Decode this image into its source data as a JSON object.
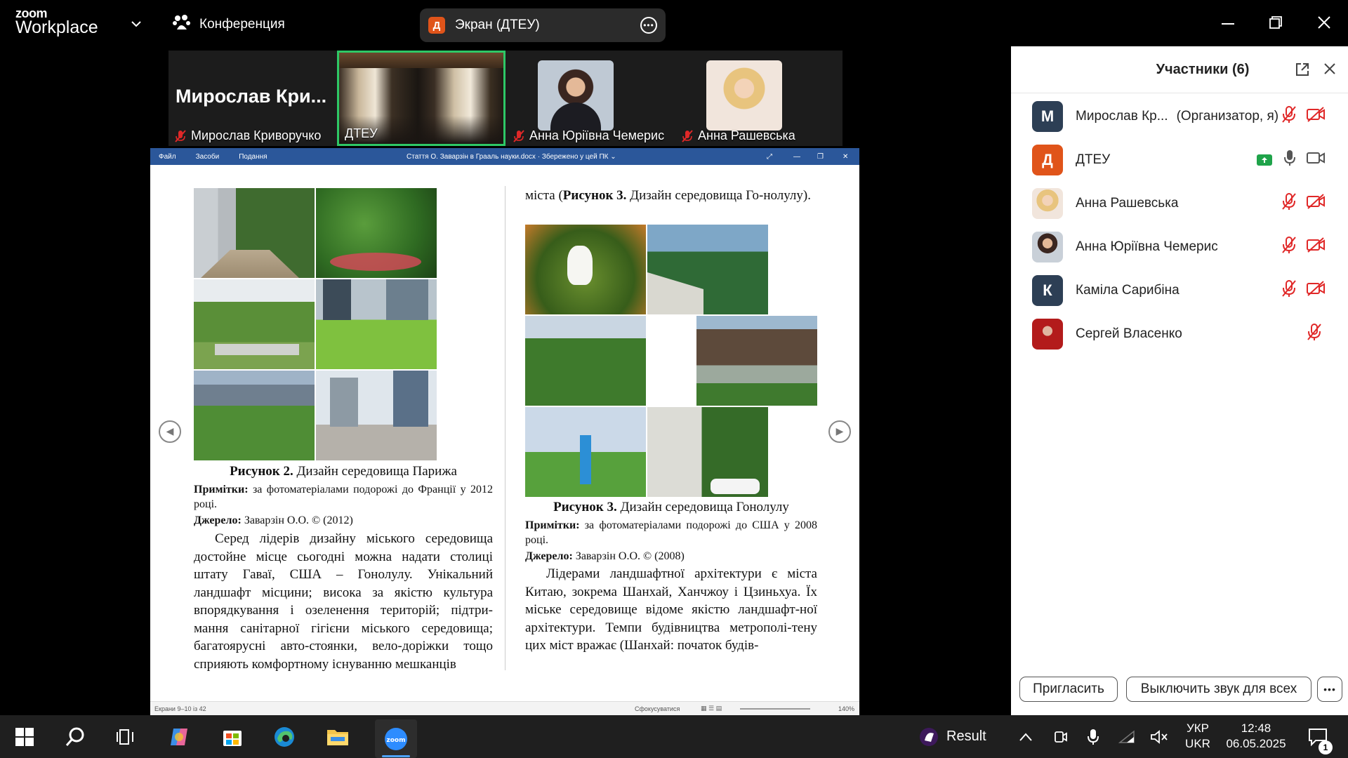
{
  "app": {
    "logo_line1": "zoom",
    "logo_line2": "Workplace",
    "meeting_menu": "Конференция",
    "share_avatar": "Д",
    "share_label": "Экран (ДТЕУ)"
  },
  "video_strip": {
    "tiles": [
      {
        "big_name": "Мирослав  Кри...",
        "label": "Мирослав Криворучко"
      },
      {
        "label": "ДТЕУ"
      },
      {
        "label": "Анна Юріївна Чемерис"
      },
      {
        "label": "Анна Рашевська"
      }
    ]
  },
  "document": {
    "menu": [
      "Файл",
      "Засоби",
      "Подання"
    ],
    "title": "Стаття О. Заварзін в Грааль науки.docx  ·  Збережено у цей ПК  ⌄",
    "status_left": "Екрани 9–10 із 42",
    "status_focus": "Сфокусуватися",
    "zoom": "140%",
    "left_col": {
      "caption_bold": "Рисунок 2.",
      "caption_text": " Дизайн середовища Парижа",
      "note_bold": "Примітки:",
      "note_text": " за фотоматеріалами подорожі до Франції у 2012 році.",
      "source_bold": "Джерело:",
      "source_text": " Заварзін О.О. © (2012)",
      "body": "Серед лідерів дизайну міського середовища достойне місце сьогодні можна надати столиці штату Гаваї, США – Гонолулу. Унікальний ландшафт місцини; висока за якістю культура впорядкування і озеленення територій; підтри-мання санітарної гігієни міського середовища; багатоярусні авто-стоянки, вело-доріжки тощо сприяють комфортному існуванню мешканців"
    },
    "right_col": {
      "top_text_1": "міста (",
      "top_text_bold": "Рисунок 3.",
      "top_text_2": " Дизайн середовища Го-нолулу).",
      "caption_bold": "Рисунок 3.",
      "caption_text": " Дизайн середовища Гонолулу",
      "note_bold": "Примітки:",
      "note_text": " за фотоматеріалами подорожі до США у 2008 році.",
      "source_bold": "Джерело:",
      "source_text": " Заварзін О.О. © (2008)",
      "body": "Лідерами ландшафтної архітектури є міста Китаю, зокрема Шанхай, Ханчжоу і Цзиньхуа. Їх міське середовище відоме якістю ландшафт-ної архітектури. Темпи будівництва метрополі-тену цих міст вражає (Шанхай: початок будів-"
    }
  },
  "participants": {
    "title": "Участники (6)",
    "list": [
      {
        "avatar": "М",
        "name": "Мирослав Кр...",
        "role": "(Организатор, я)",
        "color": "#2d3f55"
      },
      {
        "avatar": "Д",
        "name": "ДТЕУ",
        "role": "",
        "color": "#e0541a"
      },
      {
        "avatar": "",
        "name": "Анна Рашевська",
        "role": "",
        "color": "#e9c9a8"
      },
      {
        "avatar": "",
        "name": "Анна Юріївна Чемерис",
        "role": "",
        "color": "#6d4a3a"
      },
      {
        "avatar": "К",
        "name": "Каміла Сарибіна",
        "role": "",
        "color": "#2d3f55"
      },
      {
        "avatar": "",
        "name": "Сергей Власенко",
        "role": "",
        "color": "#b31b1b"
      }
    ],
    "invite_button": "Пригласить",
    "mute_all_button": "Выключить звук для всех"
  },
  "taskbar": {
    "widget_label": "Result",
    "lang_top": "УКР",
    "lang_bottom": "UKR",
    "time": "12:48",
    "date": "06.05.2025",
    "notif_count": "1"
  }
}
